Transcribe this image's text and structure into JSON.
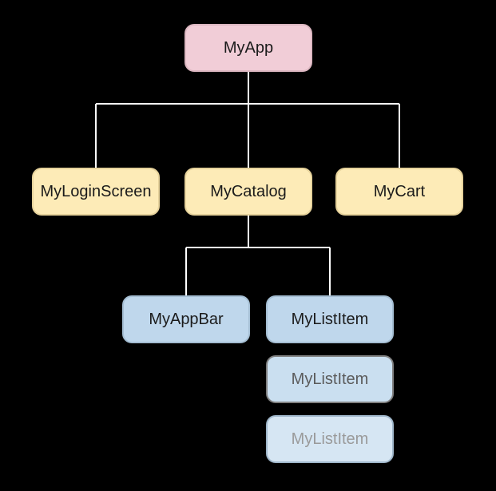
{
  "diagram": {
    "root": {
      "label": "MyApp"
    },
    "screens": {
      "login": {
        "label": "MyLoginScreen"
      },
      "catalog": {
        "label": "MyCatalog"
      },
      "cart": {
        "label": "MyCart"
      }
    },
    "catalog_children": {
      "appbar": {
        "label": "MyAppBar"
      },
      "list_items": [
        {
          "label": "MyListItem"
        },
        {
          "label": "MyListItem"
        },
        {
          "label": "MyListItem"
        }
      ]
    }
  },
  "colors": {
    "root": "#f1cdd7",
    "screen": "#fdebb7",
    "child": "#bfd7ec"
  }
}
